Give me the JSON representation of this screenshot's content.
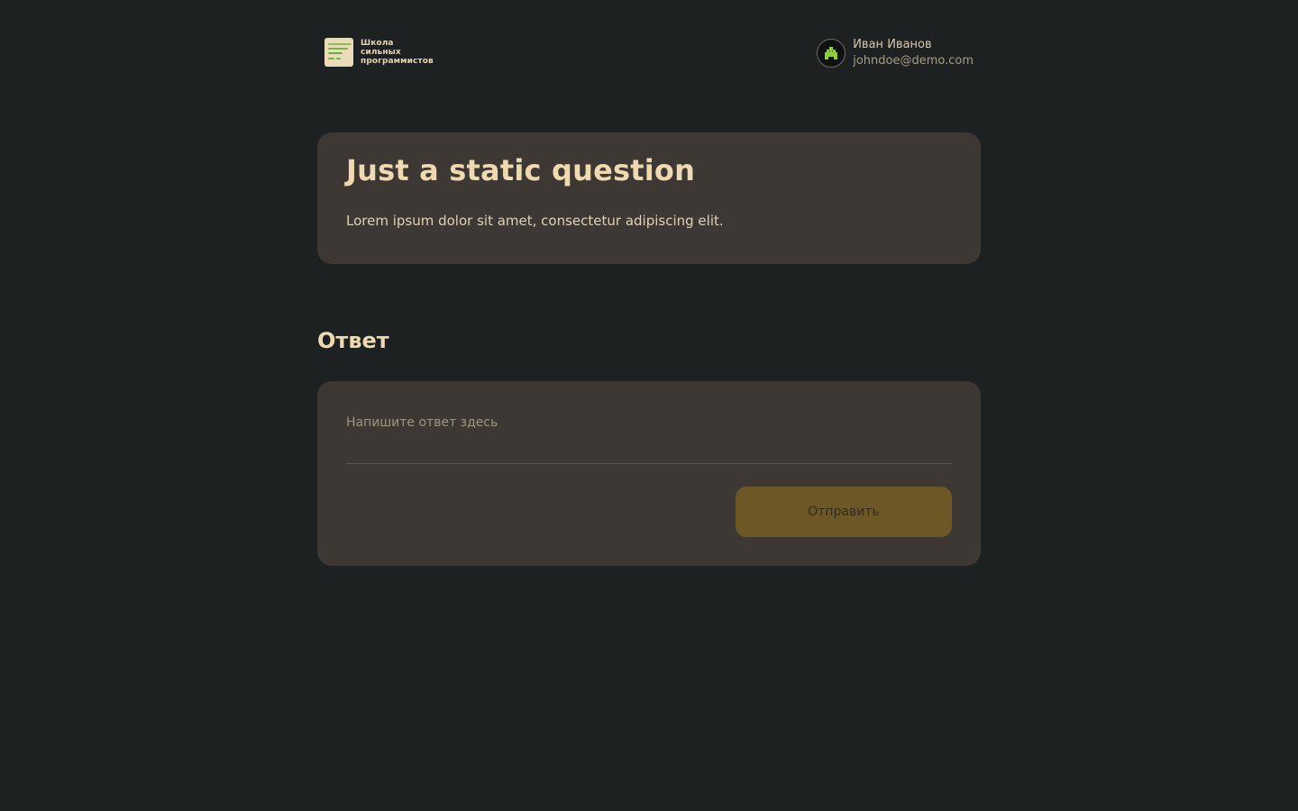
{
  "header": {
    "logo_lines": [
      "Школа",
      "сильных",
      "программистов"
    ],
    "user": {
      "name": "Иван Иванов",
      "email": "johndoe@demo.com"
    }
  },
  "question": {
    "title": "Just a static question",
    "text": "Lorem ipsum dolor sit amet, consectetur adipiscing elit."
  },
  "answer": {
    "heading": "Ответ",
    "placeholder": "Напишите ответ здесь",
    "value": "",
    "submit_label": "Отправить"
  },
  "colors": {
    "background": "#1e2122",
    "card": "#3d3834",
    "accent_text": "#efd9b0",
    "button": "#6d5727",
    "logo_line": "#6bb03d",
    "avatar_icon": "#8fd130"
  },
  "icons": {
    "logo": "document-lines-icon",
    "avatar": "pixel-creature-icon"
  }
}
